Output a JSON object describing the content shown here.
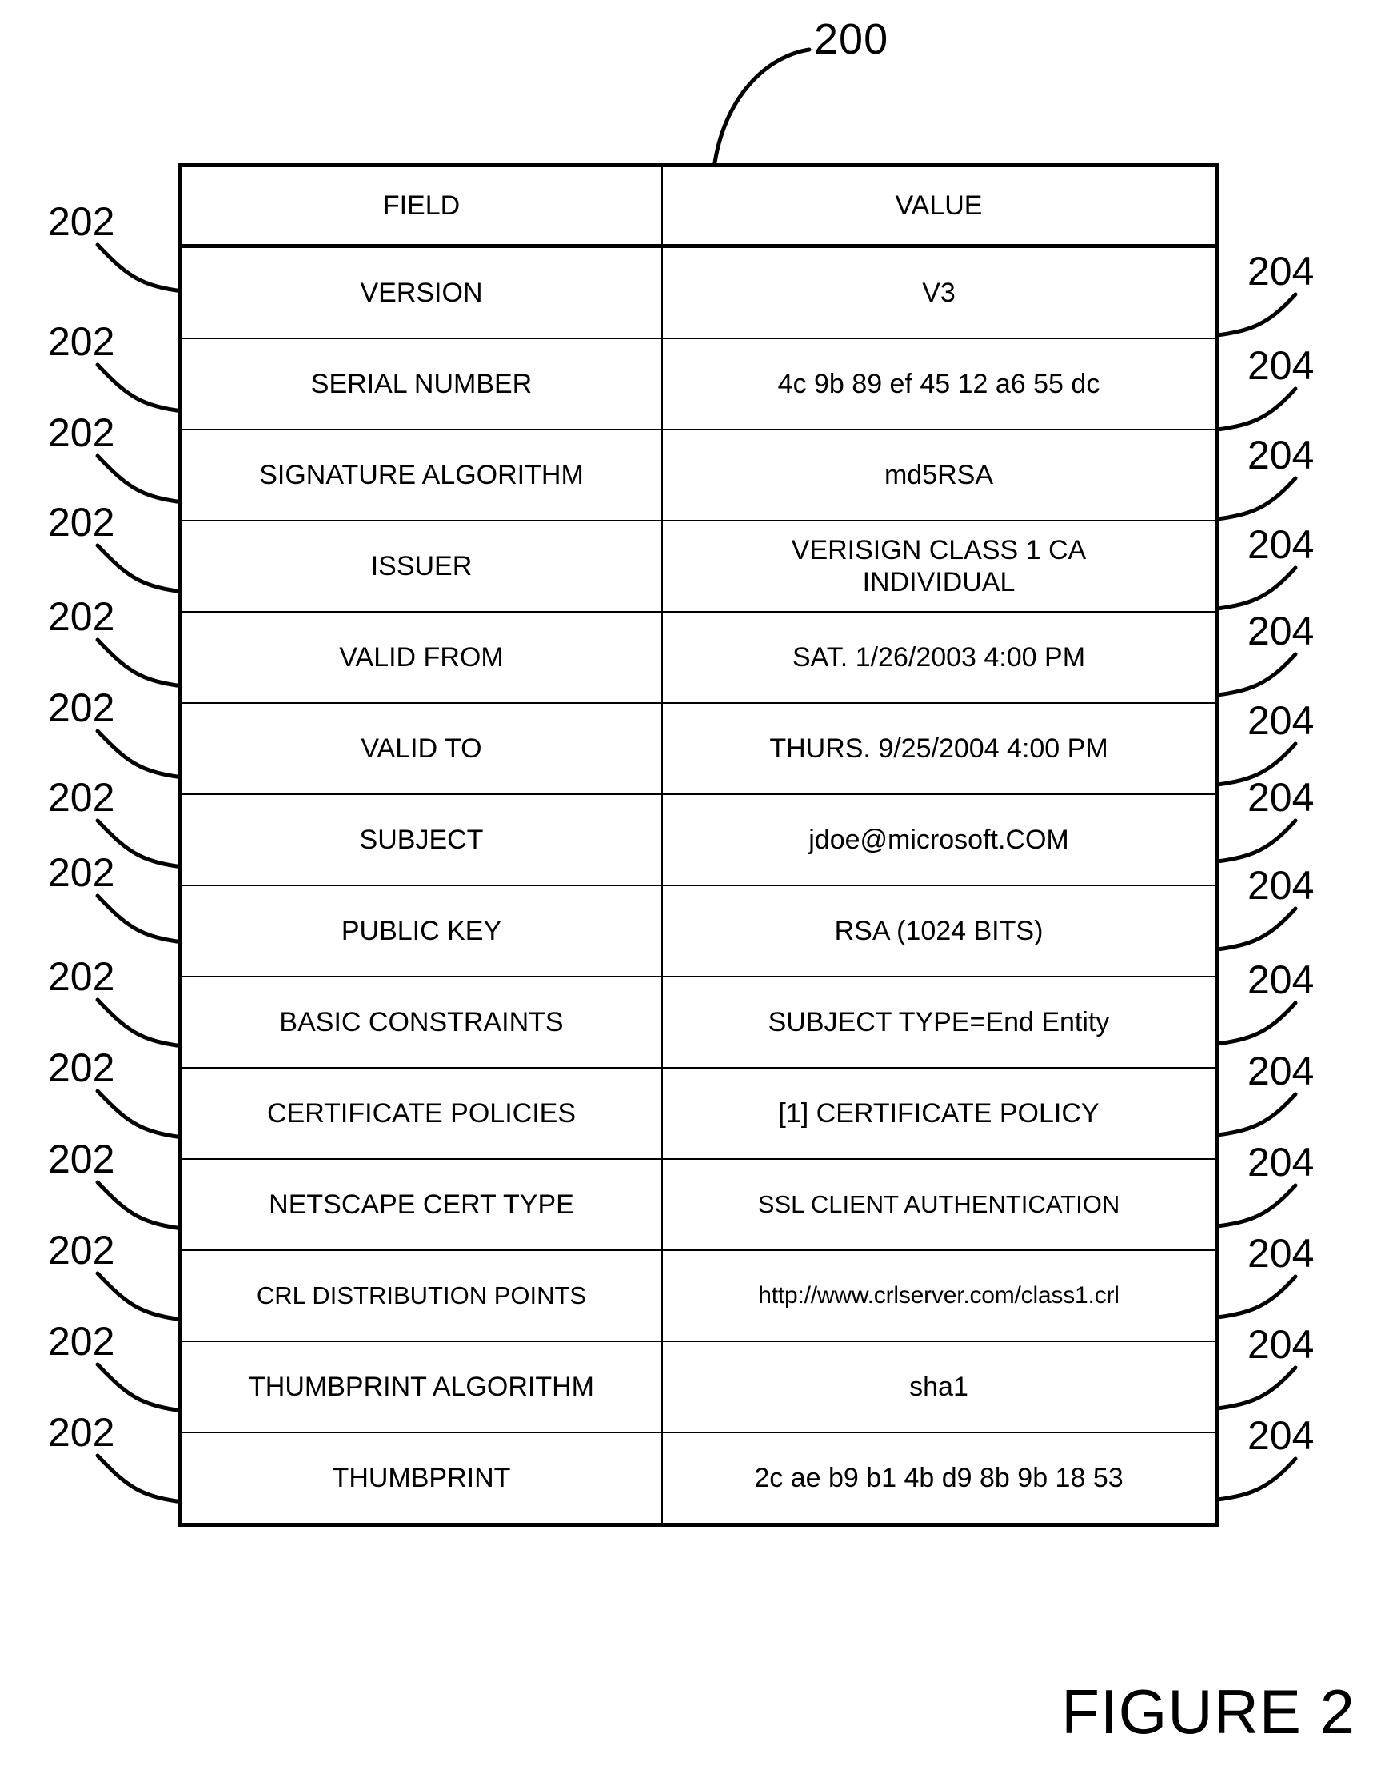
{
  "figure": {
    "caption": "FIGURE 2",
    "diagram_ref": "200",
    "field_ref": "202",
    "value_ref": "204"
  },
  "table": {
    "headers": {
      "field": "FIELD",
      "value": "VALUE"
    },
    "rows": [
      {
        "field": "VERSION",
        "value": "V3"
      },
      {
        "field": "SERIAL NUMBER",
        "value": "4c 9b 89 ef 45 12 a6 55 dc"
      },
      {
        "field": "SIGNATURE ALGORITHM",
        "value": "md5RSA"
      },
      {
        "field": "ISSUER",
        "value": "VERISIGN CLASS 1 CA\nINDIVIDUAL"
      },
      {
        "field": "VALID FROM",
        "value": "SAT. 1/26/2003 4:00 PM"
      },
      {
        "field": "VALID TO",
        "value": "THURS. 9/25/2004 4:00 PM"
      },
      {
        "field": "SUBJECT",
        "value": "jdoe@microsoft.COM"
      },
      {
        "field": "PUBLIC KEY",
        "value": "RSA (1024 BITS)"
      },
      {
        "field": "BASIC CONSTRAINTS",
        "value": "SUBJECT TYPE=End Entity"
      },
      {
        "field": "CERTIFICATE POLICIES",
        "value": "[1] CERTIFICATE POLICY"
      },
      {
        "field": "NETSCAPE CERT TYPE",
        "value": "SSL CLIENT AUTHENTICATION"
      },
      {
        "field": "CRL DISTRIBUTION POINTS",
        "value": "http://www.crlserver.com/class1.crl"
      },
      {
        "field": "THUMBPRINT ALGORITHM",
        "value": "sha1"
      },
      {
        "field": "THUMBPRINT",
        "value": "2c ae b9 b1 4b d9 8b 9b 18 53"
      }
    ]
  },
  "reference_labels": {
    "left": [
      "202",
      "202",
      "202",
      "202",
      "202",
      "202",
      "202",
      "202",
      "202",
      "202",
      "202",
      "202",
      "202",
      "202"
    ],
    "right": [
      "204",
      "204",
      "204",
      "204",
      "204",
      "204",
      "204",
      "204",
      "204",
      "204",
      "204",
      "204",
      "204",
      "204"
    ]
  },
  "colors": {
    "ink": "#000000",
    "paper": "#ffffff"
  }
}
